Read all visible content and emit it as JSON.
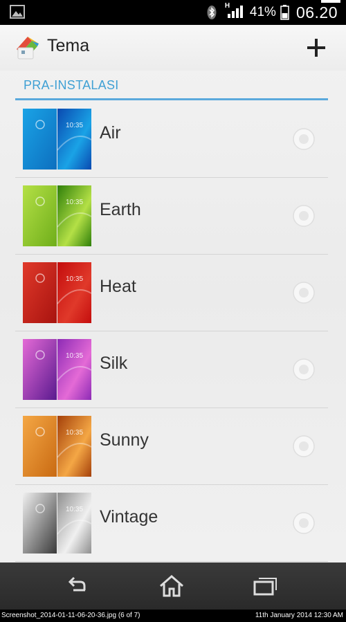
{
  "status_bar": {
    "network_type": "H",
    "battery_percent": "41%",
    "time": "06.20"
  },
  "action_bar": {
    "title": "Tema",
    "add_icon": "plus-icon",
    "app_icon": "themes-app-icon"
  },
  "section": {
    "header": "PRA-INSTALASI",
    "accent_color": "#3fa0d4"
  },
  "themes": [
    {
      "name": "Air",
      "thumb_time": "10:35",
      "colors": [
        "#0d6fbf",
        "#1aa3e6",
        "#0a49b0"
      ]
    },
    {
      "name": "Earth",
      "thumb_time": "10:35",
      "colors": [
        "#6fae1a",
        "#b4e046",
        "#2f7f0a"
      ]
    },
    {
      "name": "Heat",
      "thumb_time": "10:35",
      "colors": [
        "#a8130f",
        "#e0392a",
        "#c40d0d"
      ]
    },
    {
      "name": "Silk",
      "thumb_time": "10:35",
      "colors": [
        "#5a1a8f",
        "#e46ad6",
        "#8d2bb5"
      ]
    },
    {
      "name": "Sunny",
      "thumb_time": "10:35",
      "colors": [
        "#c96a12",
        "#f4a745",
        "#a4400a"
      ]
    },
    {
      "name": "Vintage",
      "thumb_time": "10:35",
      "colors": [
        "#3a3a3a",
        "#f0f0f0",
        "#8f8f8f"
      ]
    }
  ],
  "nav_bar": {
    "back_icon": "back-icon",
    "home_icon": "home-icon",
    "recent_icon": "recent-apps-icon"
  },
  "caption": {
    "left": "Screenshot_2014-01-11-06-20-36.jpg (6 of 7)",
    "right": "11th January 2014 12:30 AM"
  }
}
